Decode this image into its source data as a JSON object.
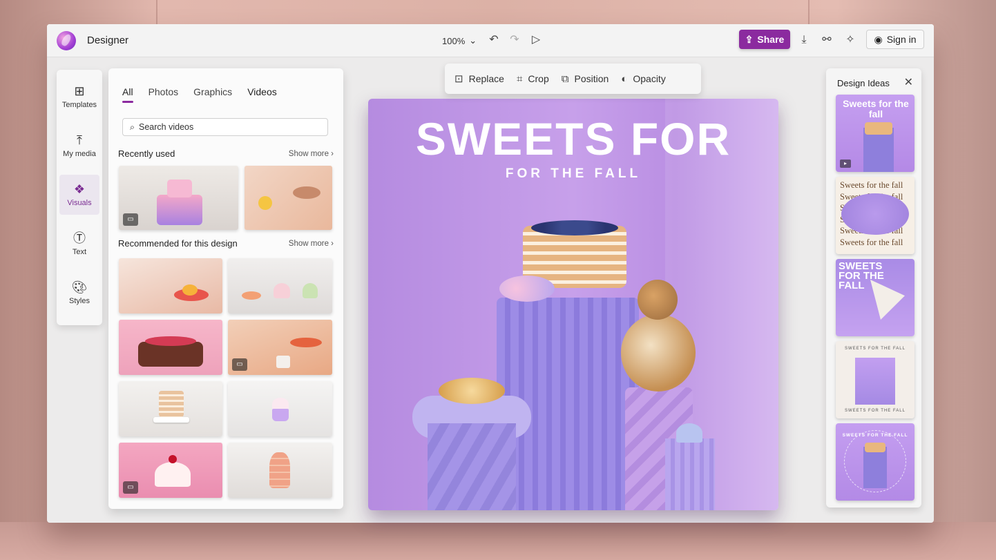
{
  "app": {
    "title": "Designer",
    "zoom": "100%"
  },
  "header": {
    "share_label": "Share",
    "signin_label": "Sign in"
  },
  "rail": {
    "items": [
      {
        "label": "Templates",
        "icon": "templates-icon"
      },
      {
        "label": "My media",
        "icon": "upload-icon"
      },
      {
        "label": "Visuals",
        "icon": "visuals-icon",
        "active": true
      },
      {
        "label": "Text",
        "icon": "text-icon"
      },
      {
        "label": "Styles",
        "icon": "palette-icon"
      }
    ]
  },
  "panel": {
    "tabs": [
      "All",
      "Photos",
      "Graphics",
      "Videos"
    ],
    "active_tab": "All",
    "search_placeholder": "Search videos",
    "recent_heading": "Recently used",
    "recommended_heading": "Recommended for this design",
    "show_more": "Show more"
  },
  "toolbar": {
    "replace": "Replace",
    "crop": "Crop",
    "position": "Position",
    "opacity": "Opacity"
  },
  "canvas": {
    "title": "SWEETS FOR",
    "subtitle": "FOR THE FALL"
  },
  "ideas": {
    "title": "Design Ideas",
    "items": [
      {
        "text": "Sweets for the fall"
      },
      {
        "text": "Sweets for the fall"
      },
      {
        "text": "SWEETS FOR THE FALL"
      },
      {
        "text": "SWEETS FOR THE FALL"
      },
      {
        "text": "SWEETS FOR THE FALL"
      }
    ]
  },
  "colors": {
    "accent": "#8b2a9f",
    "canvas": "#c7a0ea"
  }
}
